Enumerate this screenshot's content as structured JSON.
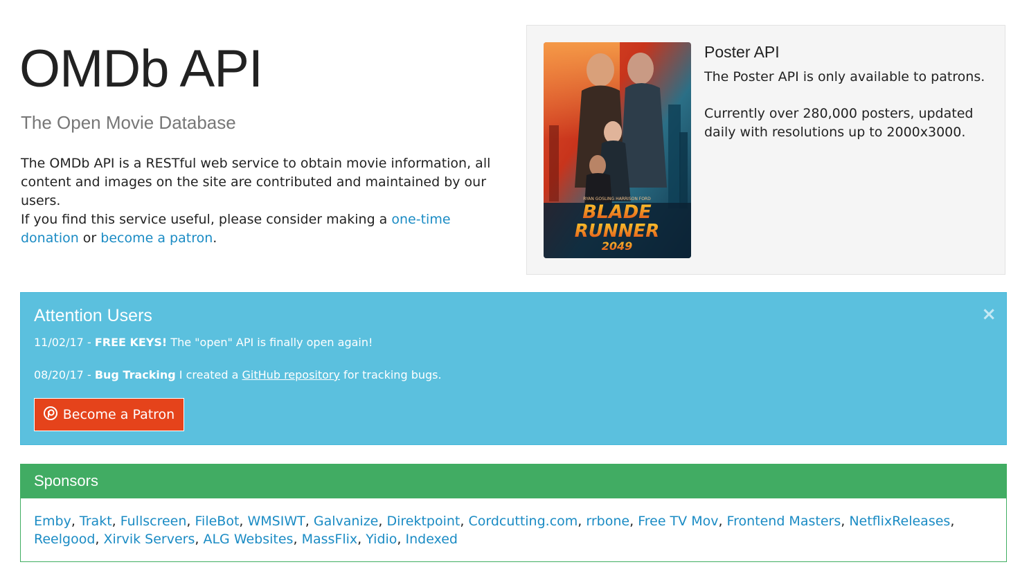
{
  "hero": {
    "title": "OMDb API",
    "subtitle": "The Open Movie Database",
    "description": "The OMDb API is a RESTful web service to obtain movie information, all content and images on the site are contributed and maintained by our users.",
    "donate_prefix": "If you find this service useful, please consider making a ",
    "donate_link": "one-time donation",
    "donate_or": " or",
    "patron_link": "become a patron",
    "donate_suffix": "."
  },
  "poster_panel": {
    "heading": "Poster API",
    "line1": "The Poster API is only available to patrons.",
    "line2": "Currently over 280,000 posters, updated daily with resolutions up to 2000x3000.",
    "poster": {
      "credits": "RYAN GOSLING   HARRISON FORD",
      "title_line1": "BLADE",
      "title_line2": "RUNNER",
      "title_line3": "2049"
    }
  },
  "attention": {
    "title": "Attention Users",
    "close_glyph": "×",
    "notices": [
      {
        "date": "11/02/17 - ",
        "label": "FREE KEYS!",
        "text": " The \"open\" API is finally open again!"
      },
      {
        "date": "08/20/17 - ",
        "label": "Bug Tracking",
        "text_before": " I created a ",
        "link": "GitHub repository",
        "text_after": " for tracking bugs."
      }
    ],
    "patron_button": "Become a Patron"
  },
  "sponsors": {
    "heading": "Sponsors",
    "list": [
      "Emby",
      "Trakt",
      "Fullscreen",
      "FileBot",
      "WMSIWT",
      "Galvanize",
      "Direktpoint",
      "Cordcutting.com",
      "rrbone",
      "Free TV Mov",
      "Frontend Masters",
      "NetflixReleases",
      "Reelgood",
      "Xirvik Servers",
      "ALG Websites",
      "MassFlix",
      "Yidio",
      "Indexed"
    ]
  },
  "colors": {
    "link": "#1a8bc4",
    "info_bg": "#5bc0de",
    "patron_orange": "#e5431b",
    "success_green": "#41ac63"
  }
}
